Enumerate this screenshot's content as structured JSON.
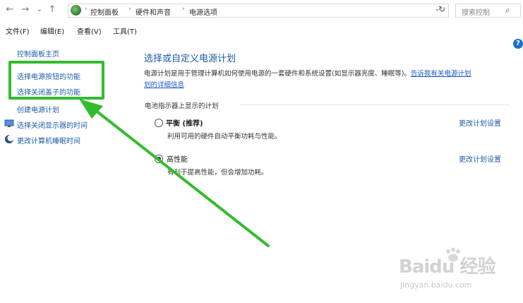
{
  "address_bar": {
    "back": "←",
    "forward": "→",
    "history": "⌄",
    "up": "↑",
    "crumbs": [
      "控制面板",
      "硬件和声音",
      "电源选项"
    ],
    "separator": "›",
    "dropdown": "⌄",
    "refresh": "↻",
    "search_placeholder": "搜索控制",
    "search_icon": "⌕"
  },
  "menu": {
    "file": "文件(F)",
    "edit": "编辑(E)",
    "view": "查看(V)",
    "tools": "工具(T)"
  },
  "left_pane": {
    "home": "控制面板主页",
    "power_buttons": "选择电源按钮的功能",
    "lid_close": "选择关闭盖子的功能",
    "create_plan": "创建电源计划",
    "display_off": "选择关闭显示器的时间",
    "sleep_time": "更改计算机睡眠时间"
  },
  "help_icon": "?",
  "main": {
    "title": "选择或自定义电源计划",
    "desc_text": "电源计划是用于管理计算机如何使用电源的一套硬件和系统设置(如显示器亮度、睡眠等)。",
    "desc_link_1": "告诉我有关电源计划",
    "desc_link_2": "划的详细信息",
    "section_label": "电池指示器上显示的计划",
    "plans": [
      {
        "name": "平衡 (推荐)",
        "desc": "利用可用的硬件自动平衡功耗与性能。",
        "selected": false,
        "change": "更改计划设置"
      },
      {
        "name": "高性能",
        "desc": "有利于提高性能，但会增加功耗。",
        "selected": true,
        "change": "更改计划设置"
      }
    ]
  },
  "watermark": {
    "main": "Baidu 经验",
    "sub": "jingyan.baidu.com"
  },
  "colors": {
    "highlight": "#34bc2e",
    "link": "#1f5ea8",
    "title": "#1b5aa6"
  }
}
